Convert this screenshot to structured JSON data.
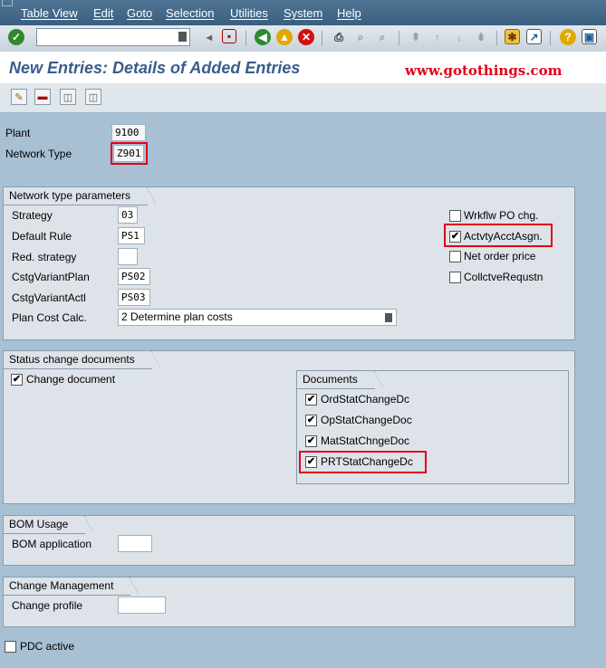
{
  "menu": [
    "Table View",
    "Edit",
    "Goto",
    "Selection",
    "Utilities",
    "System",
    "Help"
  ],
  "title": "New Entries: Details of Added Entries",
  "brand": "www.gotothings.com",
  "header": {
    "plant_label": "Plant",
    "plant_value": "9100",
    "network_type_label": "Network Type",
    "network_type_value": "Z901"
  },
  "network_params": {
    "title": "Network type parameters",
    "strategy_label": "Strategy",
    "strategy_value": "03",
    "default_rule_label": "Default Rule",
    "default_rule_value": "PS1",
    "red_strategy_label": "Red. strategy",
    "red_strategy_value": "",
    "csvplan_label": "CstgVariantPlan",
    "csvplan_value": "PS02",
    "csvactl_label": "CstgVariantActl",
    "csvactl_value": "PS03",
    "plancost_label": "Plan Cost Calc.",
    "plancost_value": "2 Determine plan costs",
    "checkboxes": [
      {
        "label": "Wrkflw PO chg.",
        "checked": false
      },
      {
        "label": "ActvtyAcctAsgn.",
        "checked": true
      },
      {
        "label": "Net order price",
        "checked": false
      },
      {
        "label": "CollctveRequstn",
        "checked": false
      }
    ]
  },
  "status_docs": {
    "title": "Status change documents",
    "change_document_label": "Change document",
    "change_document_checked": true,
    "documents_title": "Documents",
    "documents": [
      {
        "label": "OrdStatChangeDc",
        "checked": true
      },
      {
        "label": "OpStatChangeDoc",
        "checked": true
      },
      {
        "label": "MatStatChngeDoc",
        "checked": true
      },
      {
        "label": "PRTStatChangeDc",
        "checked": true
      }
    ]
  },
  "bom_usage": {
    "title": "BOM Usage",
    "bom_application_label": "BOM application",
    "bom_application_value": ""
  },
  "change_mgmt": {
    "title": "Change Management",
    "change_profile_label": "Change profile",
    "change_profile_value": ""
  },
  "pdc_active_label": "PDC active",
  "pdc_active_checked": false,
  "check_glyph": "✔"
}
